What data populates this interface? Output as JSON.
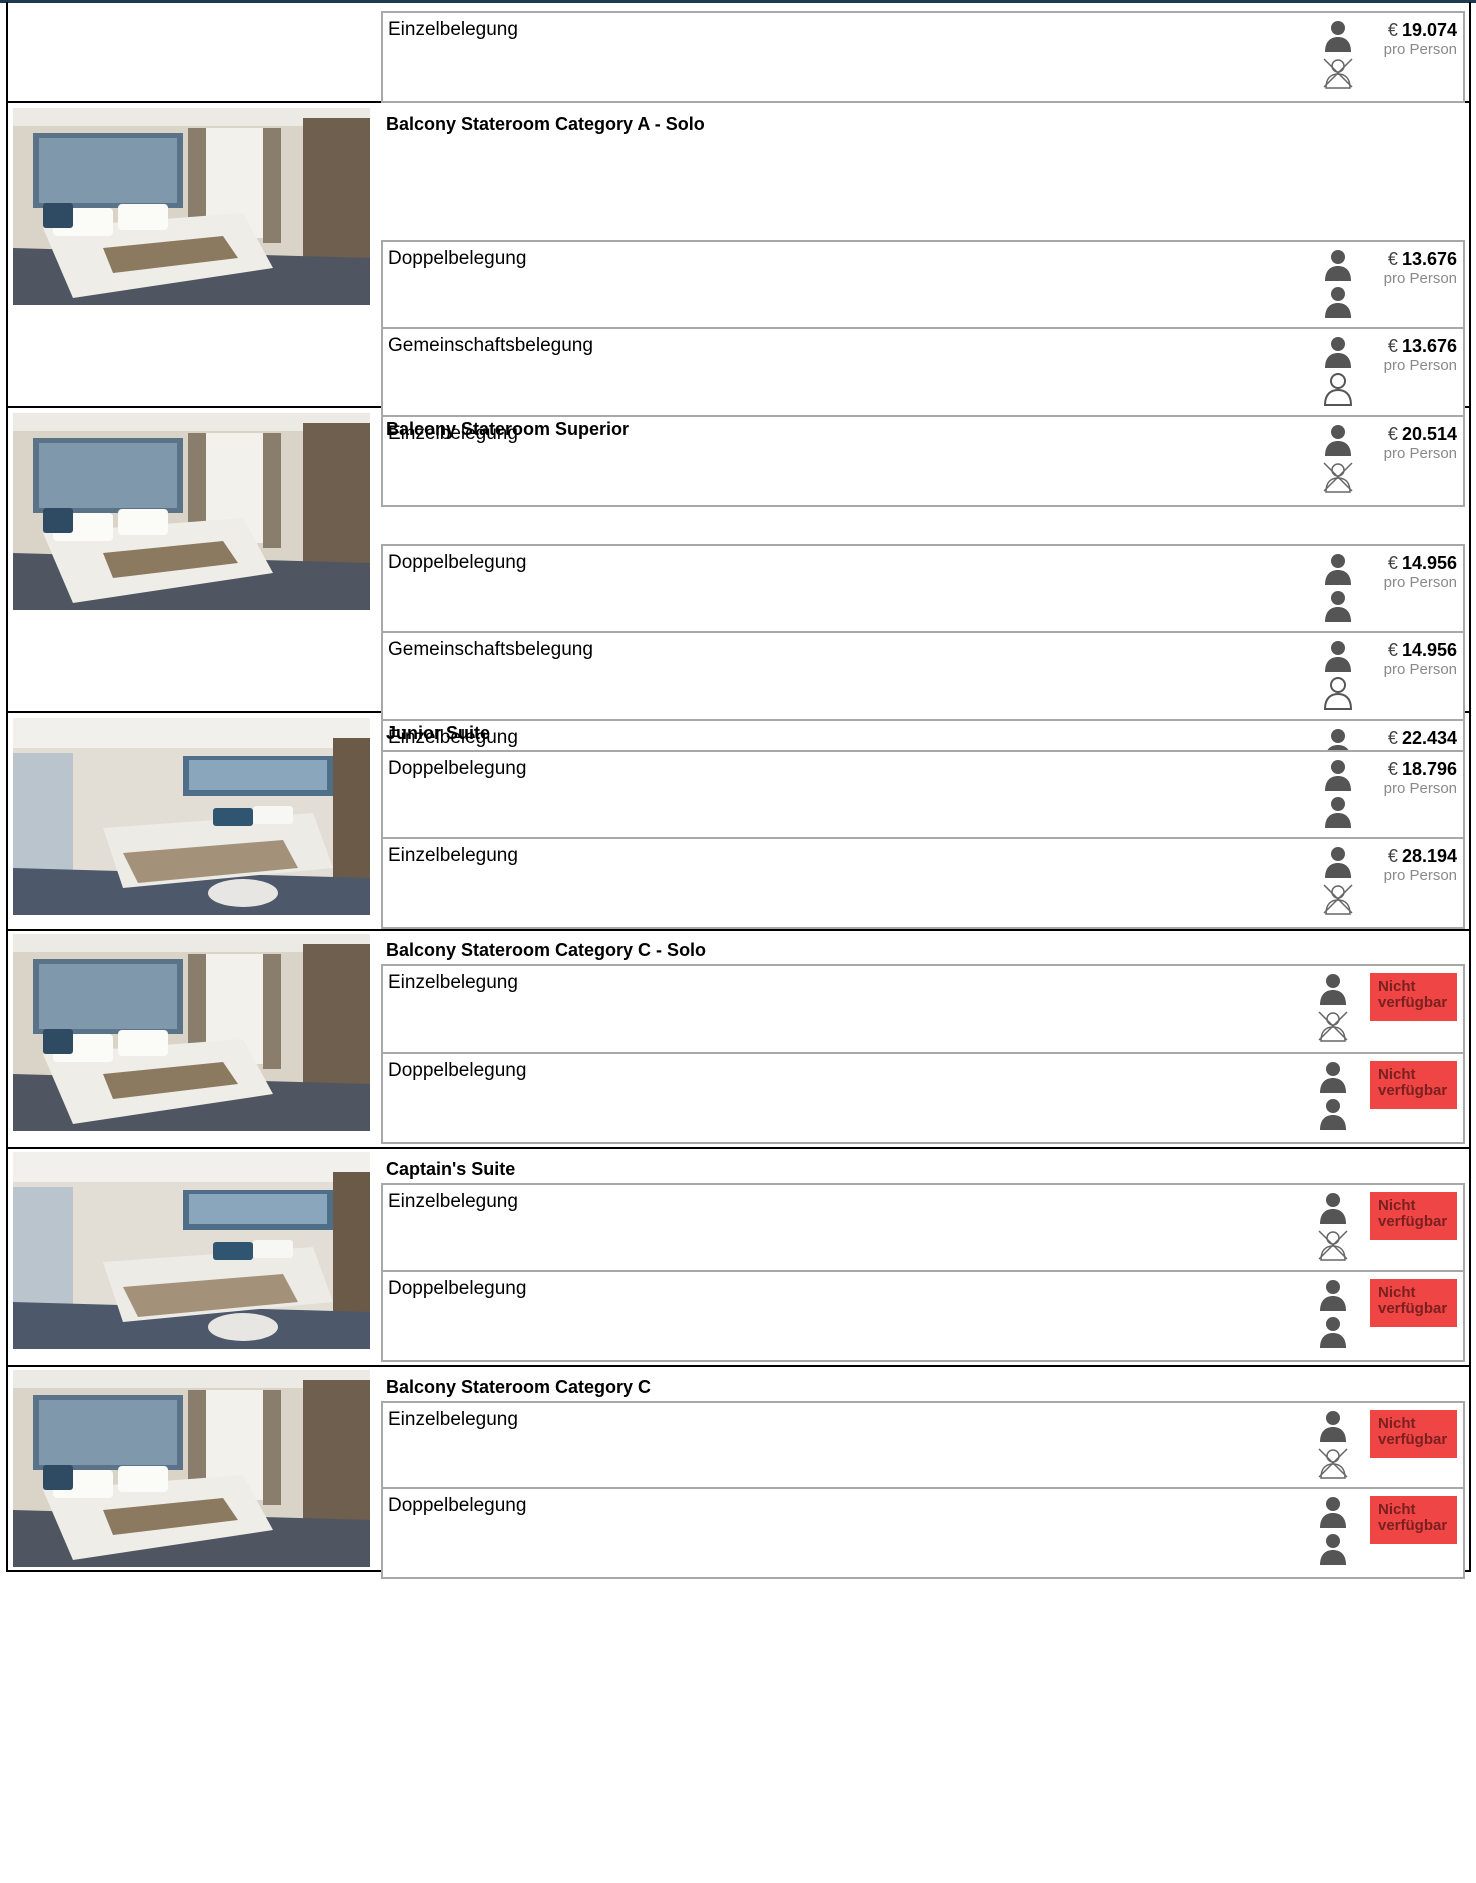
{
  "price_note": "pro Person",
  "currency_symbol": "€",
  "status_colors": {
    "not_available": "#f04545",
    "icon_gray": "#555555",
    "border": "#a8a8a8"
  },
  "icons": {
    "adult": "person-icon",
    "shared": "person-outline-icon",
    "none": "person-crossed-icon"
  },
  "cabins": [
    {
      "name": "",
      "rates": [
        {
          "label": "Einzelbelegung",
          "price": "19.074",
          "available": true,
          "occupancy": [
            "person",
            "none"
          ]
        }
      ]
    },
    {
      "name": "Balcony Stateroom Category A - Solo",
      "image": "stateroom-photo",
      "rates": [
        {
          "label": "Doppelbelegung",
          "price": "13.676",
          "available": true,
          "occupancy": [
            "person",
            "person"
          ]
        },
        {
          "label": "Gemeinschaftsbelegung",
          "price": "13.676",
          "available": true,
          "occupancy": [
            "person",
            "shared"
          ]
        },
        {
          "label": "Einzelbelegung",
          "price": "20.514",
          "available": true,
          "occupancy": [
            "person",
            "none"
          ]
        }
      ]
    },
    {
      "name": "Balcony Stateroom Superior",
      "image": "stateroom-photo",
      "rates": [
        {
          "label": "Doppelbelegung",
          "price": "14.956",
          "available": true,
          "occupancy": [
            "person",
            "person"
          ]
        },
        {
          "label": "Gemeinschaftsbelegung",
          "price": "14.956",
          "available": true,
          "occupancy": [
            "person",
            "shared"
          ]
        },
        {
          "label": "Einzelbelegung",
          "price": "22.434",
          "available": true,
          "occupancy": [
            "person",
            "none"
          ]
        }
      ]
    },
    {
      "name": "Junior Suite",
      "image": "suite-photo",
      "rates": [
        {
          "label": "Doppelbelegung",
          "price": "18.796",
          "available": true,
          "occupancy": [
            "person",
            "person"
          ]
        },
        {
          "label": "Einzelbelegung",
          "price": "28.194",
          "available": true,
          "occupancy": [
            "person",
            "none"
          ]
        }
      ]
    },
    {
      "name": "Balcony Stateroom Category C - Solo",
      "image": "stateroom-photo",
      "rates": [
        {
          "label": "Einzelbelegung",
          "available": false,
          "status": "Nicht verfügbar",
          "occupancy": [
            "person",
            "none"
          ]
        },
        {
          "label": "Doppelbelegung",
          "available": false,
          "status": "Nicht verfügbar",
          "occupancy": [
            "person",
            "person"
          ]
        }
      ]
    },
    {
      "name": "Captain's Suite",
      "image": "suite-photo",
      "rates": [
        {
          "label": "Einzelbelegung",
          "available": false,
          "status": "Nicht verfügbar",
          "occupancy": [
            "person",
            "none"
          ]
        },
        {
          "label": "Doppelbelegung",
          "available": false,
          "status": "Nicht verfügbar",
          "occupancy": [
            "person",
            "person"
          ]
        }
      ]
    },
    {
      "name": "Balcony Stateroom Category C",
      "image": "stateroom-photo",
      "rates": [
        {
          "label": "Einzelbelegung",
          "available": false,
          "status": "Nicht verfügbar",
          "occupancy": [
            "person",
            "none"
          ]
        },
        {
          "label": "Doppelbelegung",
          "available": false,
          "status": "Nicht verfügbar",
          "occupancy": [
            "person",
            "person"
          ]
        }
      ]
    }
  ]
}
